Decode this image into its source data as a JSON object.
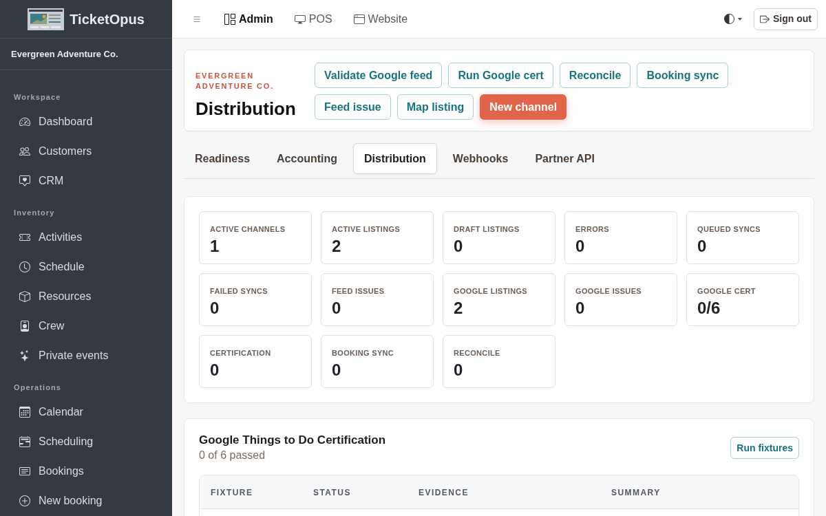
{
  "sidebar": {
    "brand": "TicketOpus",
    "organization": "Evergreen Adventure Co.",
    "sections": [
      {
        "title": "Workspace",
        "items": [
          {
            "label": "Dashboard",
            "selected": false
          },
          {
            "label": "Customers",
            "selected": false
          },
          {
            "label": "CRM",
            "selected": false
          }
        ]
      },
      {
        "title": "Inventory",
        "items": [
          {
            "label": "Activities",
            "selected": false
          },
          {
            "label": "Schedule",
            "selected": false
          },
          {
            "label": "Resources",
            "selected": false
          },
          {
            "label": "Crew",
            "selected": false
          },
          {
            "label": "Private events",
            "selected": false
          }
        ]
      },
      {
        "title": "Operations",
        "items": [
          {
            "label": "Calendar",
            "selected": false
          },
          {
            "label": "Scheduling",
            "selected": false
          },
          {
            "label": "Bookings",
            "selected": false
          },
          {
            "label": "New booking",
            "selected": false
          }
        ]
      }
    ]
  },
  "topbar": {
    "nav": [
      {
        "label": "Admin",
        "selected": true
      },
      {
        "label": "POS",
        "selected": false
      },
      {
        "label": "Website",
        "selected": false
      }
    ],
    "theme_toggle": {
      "expanded": false
    },
    "sign_out": "Sign out"
  },
  "page_header": {
    "eyebrow": "EVERGREEN ADVENTURE CO.",
    "title": "Distribution",
    "actions": [
      {
        "label": "Validate Google feed",
        "kind": "outline"
      },
      {
        "label": "Run Google cert",
        "kind": "outline"
      },
      {
        "label": "Reconcile",
        "kind": "outline"
      },
      {
        "label": "Booking sync",
        "kind": "outline"
      },
      {
        "label": "Feed issue",
        "kind": "outline"
      },
      {
        "label": "Map listing",
        "kind": "outline"
      },
      {
        "label": "New channel",
        "kind": "primary"
      }
    ]
  },
  "tabs": [
    {
      "label": "Readiness",
      "selected": false
    },
    {
      "label": "Accounting",
      "selected": false
    },
    {
      "label": "Distribution",
      "selected": true
    },
    {
      "label": "Webhooks",
      "selected": false
    },
    {
      "label": "Partner API",
      "selected": false
    }
  ],
  "stats": [
    {
      "label": "ACTIVE CHANNELS",
      "value": "1"
    },
    {
      "label": "ACTIVE LISTINGS",
      "value": "2"
    },
    {
      "label": "DRAFT LISTINGS",
      "value": "0"
    },
    {
      "label": "ERRORS",
      "value": "0"
    },
    {
      "label": "QUEUED SYNCS",
      "value": "0"
    },
    {
      "label": "FAILED SYNCS",
      "value": "0"
    },
    {
      "label": "FEED ISSUES",
      "value": "0"
    },
    {
      "label": "GOOGLE LISTINGS",
      "value": "2"
    },
    {
      "label": "GOOGLE ISSUES",
      "value": "0"
    },
    {
      "label": "GOOGLE CERT",
      "value": "0/6"
    },
    {
      "label": "CERTIFICATION",
      "value": "0"
    },
    {
      "label": "BOOKING SYNC",
      "value": "0"
    },
    {
      "label": "RECONCILE",
      "value": "0"
    }
  ],
  "certification": {
    "title": "Google Things to Do Certification",
    "summary": "0 of 6 passed",
    "action": "Run fixtures",
    "table": {
      "columns": [
        "FIXTURE",
        "STATUS",
        "EVIDENCE",
        "SUMMARY"
      ]
    }
  }
}
